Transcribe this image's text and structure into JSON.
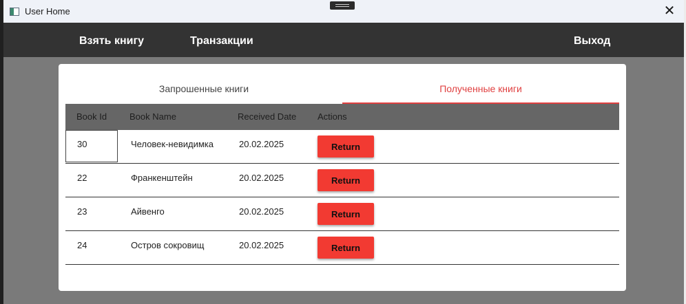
{
  "window": {
    "title": "User Home"
  },
  "nav": {
    "borrow": "Взять книгу",
    "transactions": "Транзакции",
    "exit": "Выход"
  },
  "tabs": {
    "requested": "Запрошенные книги",
    "received": "Полученные книги",
    "active": "received"
  },
  "table": {
    "columns": [
      "Book Id",
      "Book Name",
      "Received Date",
      "Actions"
    ],
    "rows": [
      {
        "id": "30",
        "name": "Человек-невидимка",
        "date": "20.02.2025",
        "action": "Return"
      },
      {
        "id": "22",
        "name": "Франкенштейн",
        "date": "20.02.2025",
        "action": "Return"
      },
      {
        "id": "23",
        "name": "Айвенго",
        "date": "20.02.2025",
        "action": "Return"
      },
      {
        "id": "24",
        "name": "Остров сокровищ",
        "date": "20.02.2025",
        "action": "Return"
      }
    ]
  },
  "colors": {
    "navbar": "#333333",
    "accent": "#e04040",
    "button": "#f23a32",
    "table_header": "#666666",
    "overlay": "#7a7a7a"
  },
  "icons": {
    "app": "app-window-icon",
    "close": "close-icon"
  }
}
